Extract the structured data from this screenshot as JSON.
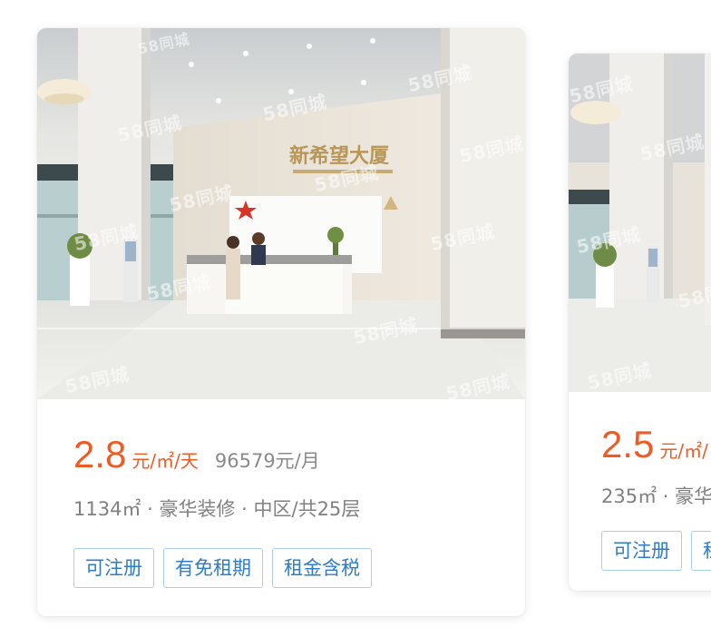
{
  "listings": [
    {
      "image_alt": "办公楼大堂照片",
      "watermark": "58同城",
      "photo_sign": "新希望大厦",
      "price_value": "2.8",
      "price_unit": "元/㎡/天",
      "price_month": "96579元/月",
      "info": "1134㎡ · 豪华装修 · 中区/共25层",
      "tags": [
        "可注册",
        "有免租期",
        "租金含税"
      ]
    },
    {
      "image_alt": "办公楼大堂照片",
      "watermark": "58同城",
      "price_value": "2.5",
      "price_unit": "元/㎡/",
      "info": "235㎡ · 豪华",
      "tags": [
        "可注册",
        "租"
      ]
    }
  ],
  "colors": {
    "price": "#f05a24",
    "tag_text": "#2f7cc9",
    "tag_border": "#a9cdee",
    "meta_text": "#808080"
  }
}
